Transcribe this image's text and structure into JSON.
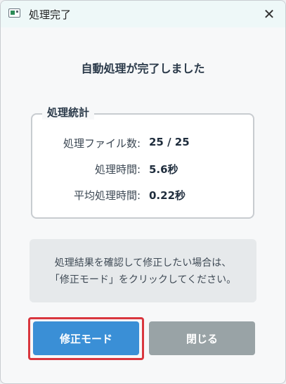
{
  "window": {
    "title": "処理完了",
    "close_glyph": "✕"
  },
  "heading": "自動処理が完了しました",
  "stats": {
    "legend": "処理統計",
    "rows": [
      {
        "label": "処理ファイル数:",
        "value": "25 / 25"
      },
      {
        "label": "処理時間:",
        "value": "5.6秒"
      },
      {
        "label": "平均処理時間:",
        "value": "0.22秒"
      }
    ]
  },
  "info": {
    "line1": "処理結果を確認して修正したい場合は、",
    "line2": "「修正モード」をクリックしてください。"
  },
  "buttons": {
    "edit_mode": "修正モード",
    "close": "閉じる"
  },
  "colors": {
    "primary": "#3a8fd6",
    "secondary": "#99a3a6",
    "focus": "#d9363e"
  }
}
